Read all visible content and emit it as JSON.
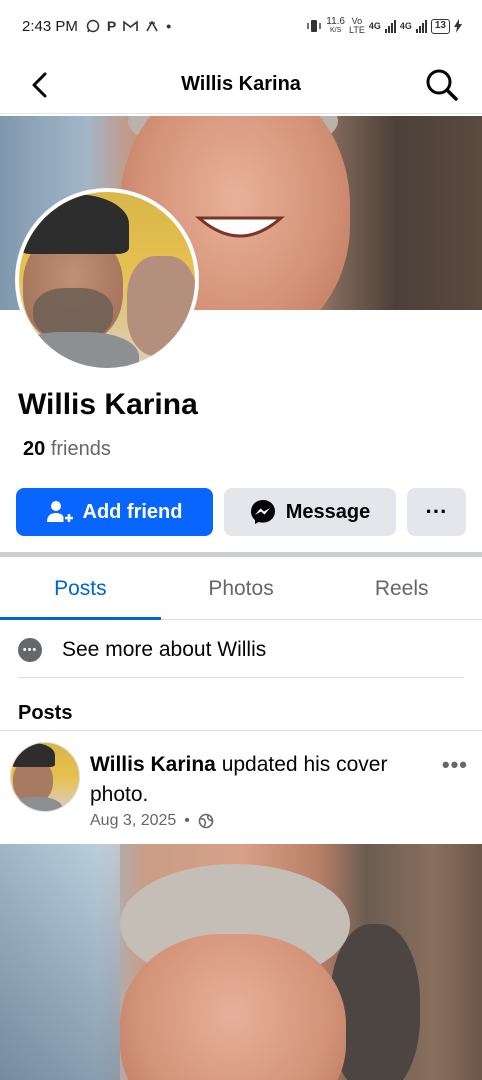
{
  "status_bar": {
    "time": "2:43 PM",
    "left_icons": [
      "whatsapp-icon",
      "p-icon",
      "gmail-icon",
      "app-icon"
    ],
    "dot": "•",
    "speed_value": "11.6",
    "speed_unit": "K/S",
    "volte_top": "Vo",
    "volte_bottom": "LTE",
    "net1": "4G",
    "net2": "4G",
    "battery": "13"
  },
  "header": {
    "title": "Willis Karina",
    "back_icon": "back-arrow-icon",
    "search_icon": "search-icon"
  },
  "profile": {
    "name": "Willis Karina",
    "friends_count": "20",
    "friends_label": "friends"
  },
  "actions": {
    "add_friend": "Add friend",
    "message": "Message",
    "more": "···"
  },
  "tabs": [
    {
      "label": "Posts",
      "active": true
    },
    {
      "label": "Photos",
      "active": false
    },
    {
      "label": "Reels",
      "active": false
    }
  ],
  "see_more": {
    "label": "See more about Willis"
  },
  "posts_section": {
    "heading": "Posts"
  },
  "post": {
    "author": "Willis Karina",
    "action": "updated his cover photo.",
    "date": "Aug 3, 2025",
    "separator": "•",
    "privacy_icon": "globe-icon",
    "more": "•••"
  },
  "colors": {
    "primary": "#0866ff",
    "secondary_button": "#e4e6eb",
    "active_tab": "#0064d1",
    "muted_text": "#65676b"
  }
}
